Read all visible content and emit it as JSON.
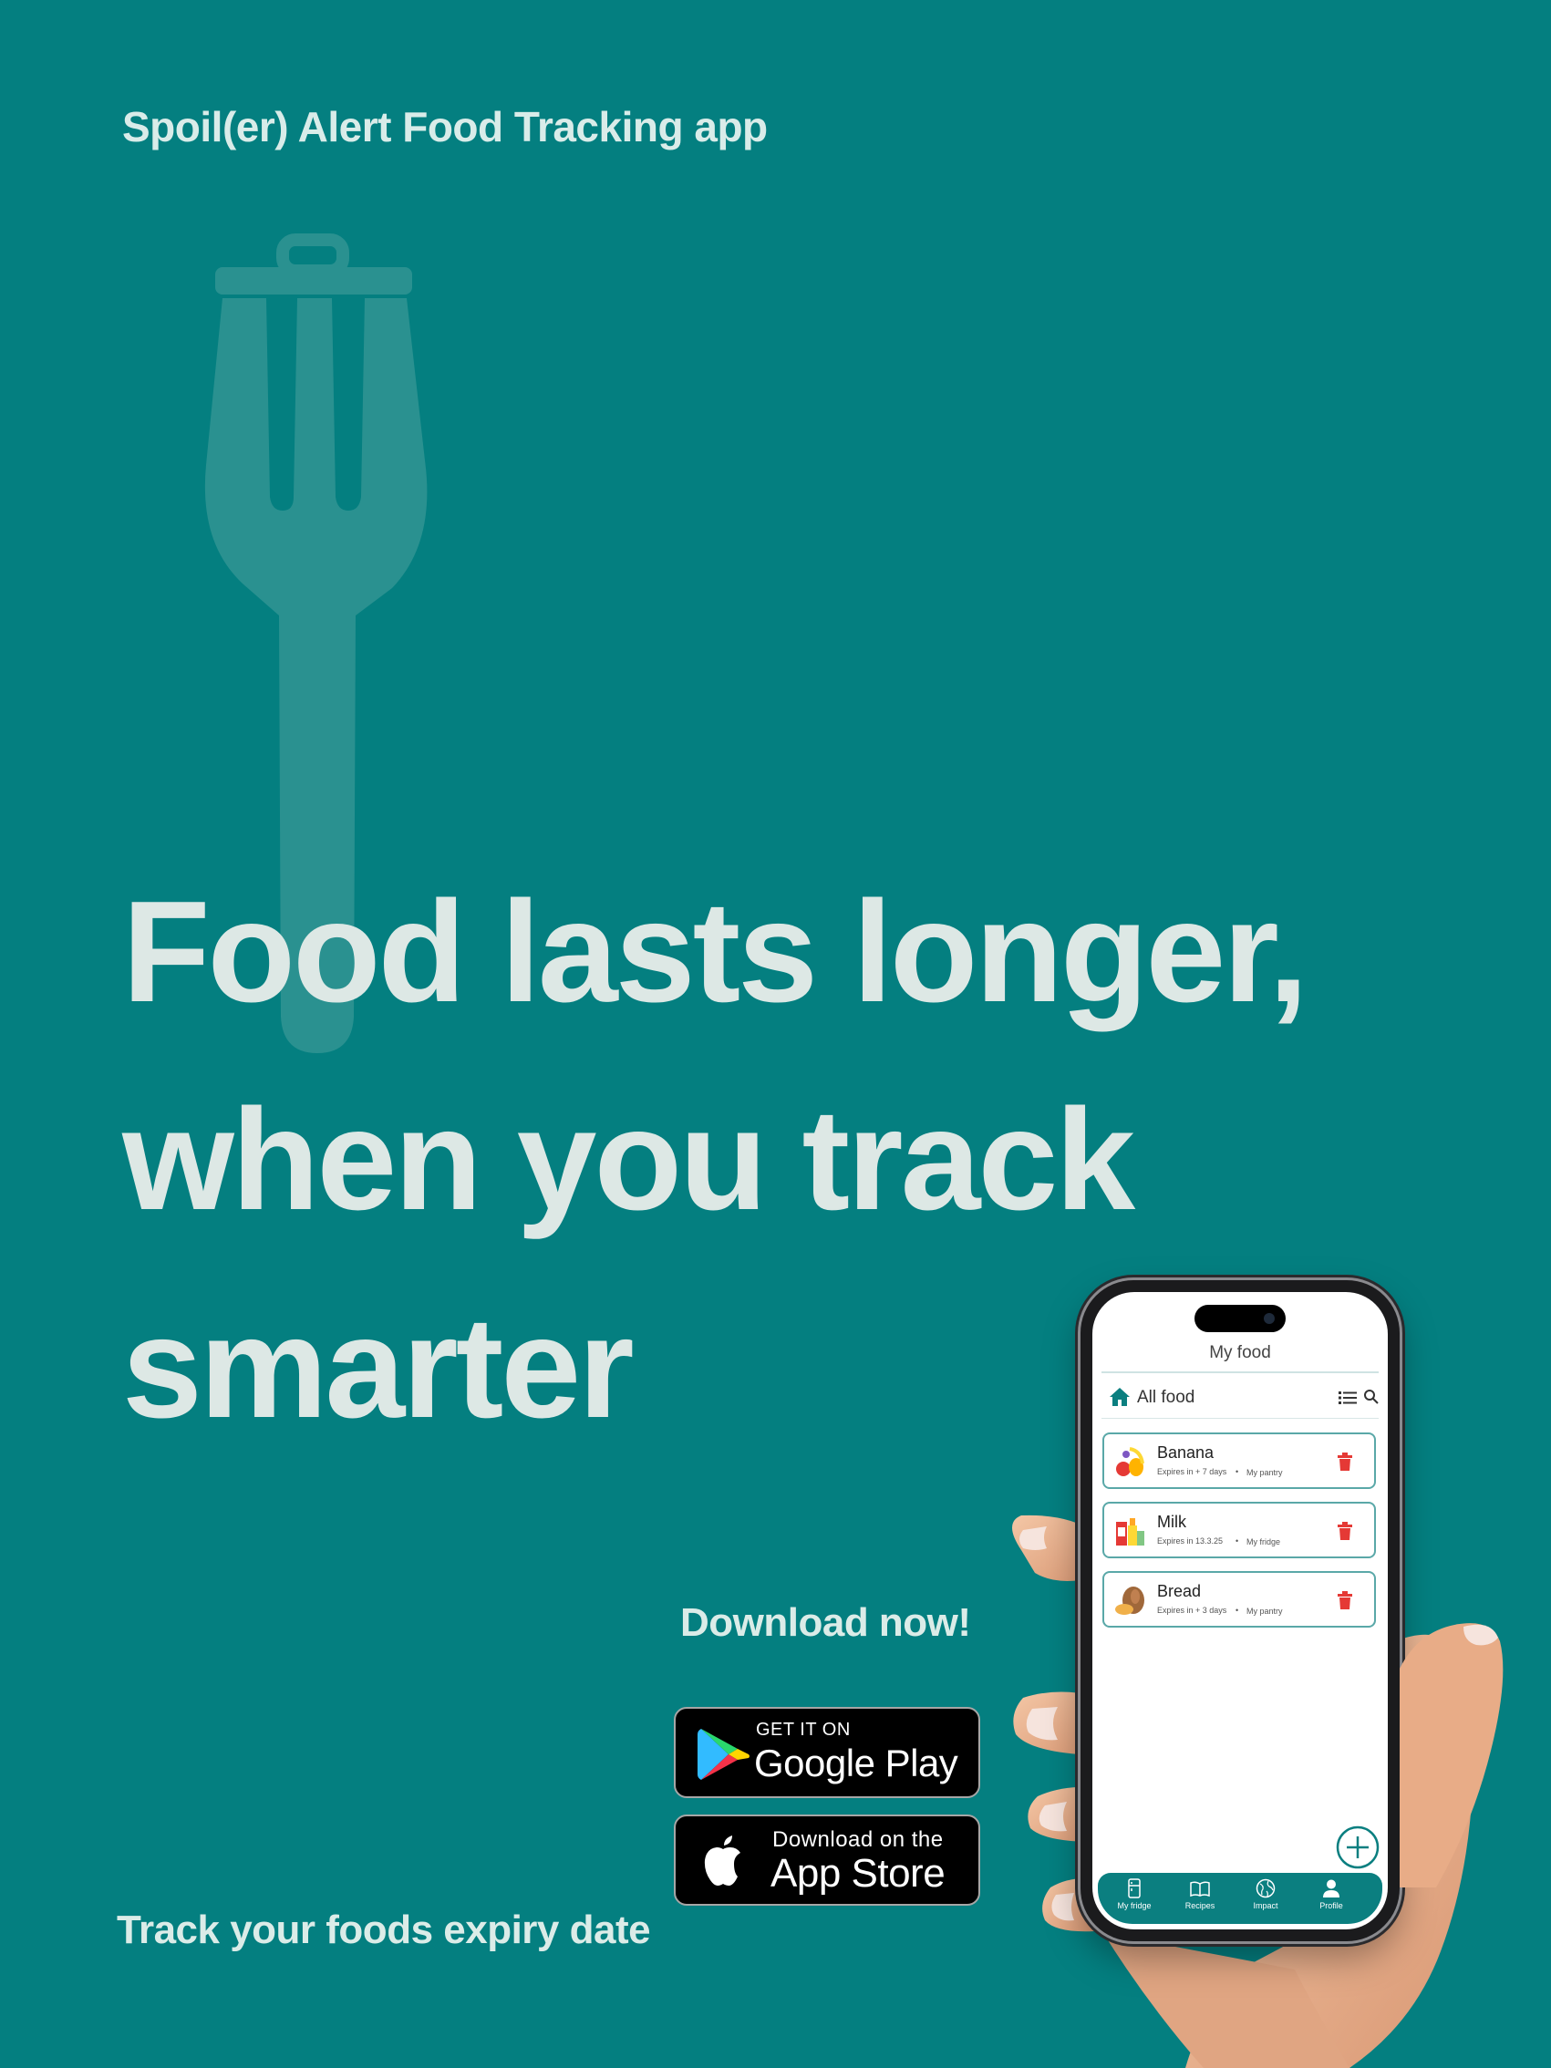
{
  "app_name": "Spoil(er) Alert Food Tracking app",
  "headline": [
    "Food lasts longer,",
    "when you track",
    "smarter"
  ],
  "download_now": "Download now!",
  "store_badges": {
    "google": {
      "small": "GET IT ON",
      "big": "Google Play"
    },
    "apple": {
      "small": "Download on the",
      "big": "App Store"
    }
  },
  "tagline": "Track your foods expiry date",
  "phone": {
    "screen_title": "My food",
    "filter_label": "All food",
    "items": [
      {
        "name": "Banana",
        "expiry": "Expires in + 7 days",
        "location": "My pantry"
      },
      {
        "name": "Milk",
        "expiry": "Expires in 13.3.25",
        "location": "My fridge"
      },
      {
        "name": "Bread",
        "expiry": "Expires in + 3 days",
        "location": "My pantry"
      }
    ],
    "separator": "•",
    "nav": [
      {
        "label": "My fridge",
        "icon": "fridge-icon"
      },
      {
        "label": "Recipes",
        "icon": "book-icon"
      },
      {
        "label": "Impact",
        "icon": "globe-icon"
      },
      {
        "label": "Profile",
        "icon": "profile-icon"
      }
    ]
  },
  "colors": {
    "background": "#047f80",
    "headline": "#dde8e5",
    "accent": "#0b7f80",
    "delete": "#e53935"
  }
}
